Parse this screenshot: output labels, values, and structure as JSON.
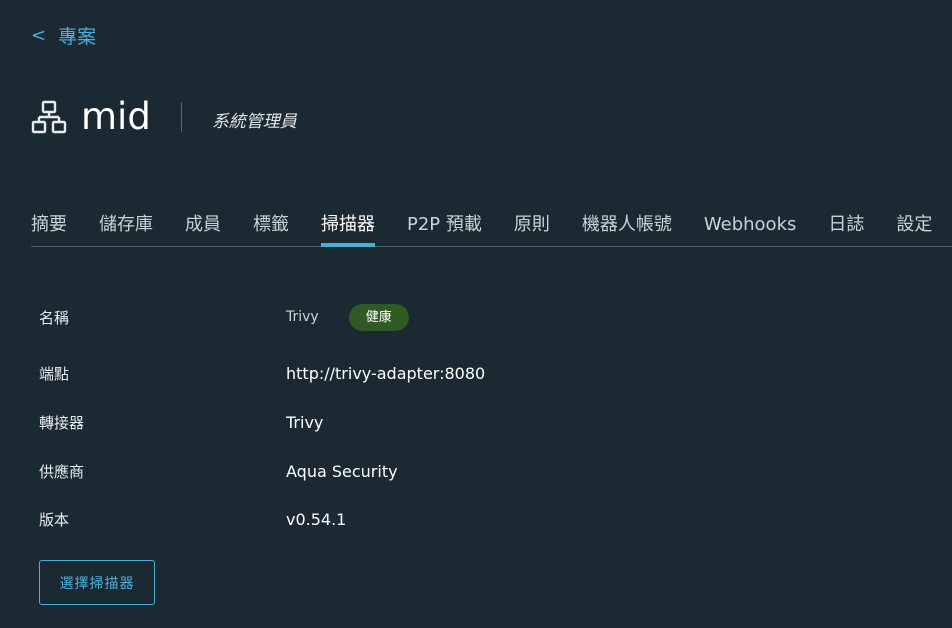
{
  "breadcrumb": {
    "back_icon": "chevron-left-icon",
    "label": "專案"
  },
  "project": {
    "icon": "project-network-icon",
    "name": "mid",
    "role": "系統管理員"
  },
  "tabs": [
    {
      "label": "摘要",
      "active": false
    },
    {
      "label": "儲存庫",
      "active": false
    },
    {
      "label": "成員",
      "active": false
    },
    {
      "label": "標籤",
      "active": false
    },
    {
      "label": "掃描器",
      "active": true
    },
    {
      "label": "P2P 預載",
      "active": false
    },
    {
      "label": "原則",
      "active": false
    },
    {
      "label": "機器人帳號",
      "active": false
    },
    {
      "label": "Webhooks",
      "active": false
    },
    {
      "label": "日誌",
      "active": false
    },
    {
      "label": "設定",
      "active": false
    }
  ],
  "scanner": {
    "name_label": "名稱",
    "name_value": "Trivy",
    "health_badge": "健康",
    "endpoint_label": "端點",
    "endpoint_value": "http://trivy-adapter:8080",
    "adapter_label": "轉接器",
    "adapter_value": "Trivy",
    "vendor_label": "供應商",
    "vendor_value": "Aqua Security",
    "version_label": "版本",
    "version_value": "v0.54.1"
  },
  "actions": {
    "select_scanner_label": "選擇掃描器"
  },
  "colors": {
    "background": "#1b2a32",
    "accent": "#4aaed9",
    "healthy": "#2f5a23"
  }
}
